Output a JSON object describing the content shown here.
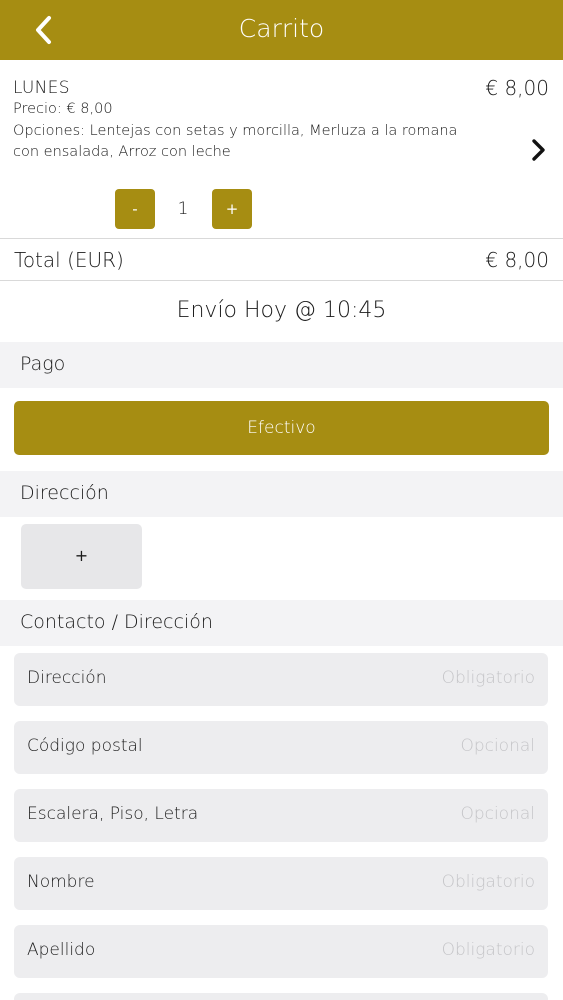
{
  "header": {
    "title": "Carrito",
    "back_icon": "chevron-left-icon",
    "color": "#a68d12"
  },
  "cart_item": {
    "name": "LUNES",
    "price": "Precio: € 8,00",
    "options_line1": "Opciones: Lentejas con setas y morcilla, Merluza a la romana",
    "options_line2": "con ensalada, Arroz con leche",
    "total": "€ 8,00",
    "quantity": "1",
    "minus_label": "-",
    "plus_label": "+"
  },
  "total": {
    "label": "Total (EUR)",
    "value": "€ 8,00"
  },
  "delivery": "Envío Hoy @ 10:45",
  "payment": {
    "section_title": "Pago",
    "method_label": "Efectivo"
  },
  "address": {
    "section_title": "Dirección",
    "add_label": "+"
  },
  "contact": {
    "section_title": "Contacto / Dirección",
    "fields": [
      {
        "label": "Dirección",
        "placeholder": "Obligatorio"
      },
      {
        "label": "Código postal",
        "placeholder": "Opcional"
      },
      {
        "label": "Escalera, Piso, Letra",
        "placeholder": "Opcional"
      },
      {
        "label": "Nombre",
        "placeholder": "Obligatorio"
      },
      {
        "label": "Apellido",
        "placeholder": "Obligatorio"
      }
    ]
  }
}
